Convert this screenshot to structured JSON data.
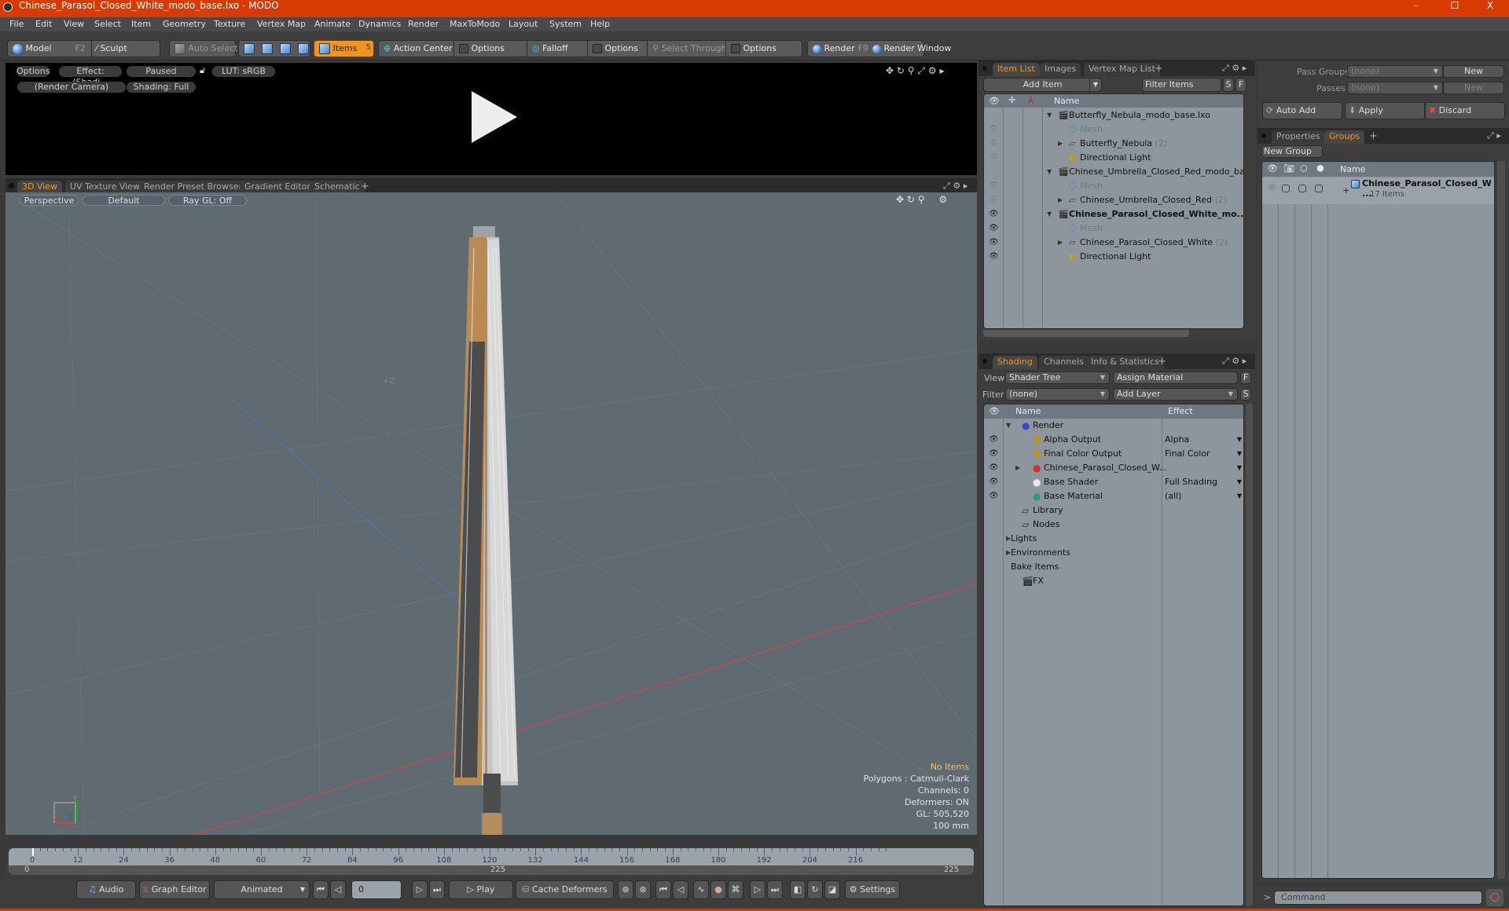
{
  "window": {
    "title": "Chinese_Parasol_Closed_White_modo_base.lxo - MODO",
    "controls": [
      "–",
      "☐",
      "X"
    ]
  },
  "menu": [
    "File",
    "Edit",
    "View",
    "Select",
    "Item",
    "Geometry",
    "Texture",
    "Vertex Map",
    "Animate",
    "Dynamics",
    "Render",
    "MaxToModo",
    "Layout",
    "System",
    "Help"
  ],
  "toolbar": {
    "model": "Model",
    "model_key": "F2",
    "sculpt": "Sculpt",
    "auto_select": "Auto Select",
    "items": "Items",
    "items_count": "5",
    "action_center": "Action Center",
    "options1": "Options",
    "falloff": "Falloff",
    "options2": "Options",
    "select_through": "Select Through",
    "options3": "Options",
    "render": "Render",
    "render_key": "F9",
    "render_window": "Render Window",
    "accent": "#f0961f"
  },
  "render_preview": {
    "options": "Options",
    "effect": "Effect: (Shadi...",
    "status": "Paused",
    "lut": "LUT: sRGB",
    "camera": "(Render Camera)",
    "shading": "Shading: Full"
  },
  "viewport_tabs": [
    "3D View",
    "UV Texture View",
    "Render Preset Browser",
    "Gradient Editor",
    "Schematic"
  ],
  "viewport": {
    "projection": "Perspective",
    "style": "Default",
    "raygl": "Ray GL: Off",
    "axis_label": "+Z",
    "info": {
      "selection": "No Items",
      "polygons": "Polygons : Catmull-Clark",
      "channels": "Channels: 0",
      "deformers": "Deformers: ON",
      "gl": "GL: 505,520",
      "scale": "100 mm"
    }
  },
  "timeline": {
    "ticks": [
      "0",
      "12",
      "24",
      "36",
      "48",
      "60",
      "72",
      "84",
      "96",
      "108",
      "120",
      "132",
      "144",
      "156",
      "168",
      "180",
      "192",
      "204",
      "216"
    ],
    "range_start": "0",
    "range_mid": "225",
    "range_end": "225",
    "current_frame": 0,
    "max_frame": 225
  },
  "transport": {
    "audio": "Audio",
    "graph_editor": "Graph Editor",
    "animated": "Animated",
    "frame": "0",
    "play": "Play",
    "cache_deformers": "Cache Deformers",
    "settings": "Settings"
  },
  "item_list": {
    "tabs": [
      "Item List",
      "Images",
      "Vertex Map List"
    ],
    "add_item": "Add Item",
    "filter_items": "Filter Items",
    "s_btn": "S",
    "f_btn": "F",
    "col_name": "Name",
    "rows": [
      {
        "name": "Butterfly_Nebula_modo_base.lxo",
        "type": "scene",
        "depth": 0,
        "eye": "none",
        "expand": "open"
      },
      {
        "name": "Mesh",
        "type": "mesh",
        "depth": 1,
        "eye": "dim",
        "dim": true
      },
      {
        "name": "Butterfly_Nebula",
        "count": "(2)",
        "type": "group",
        "depth": 1,
        "eye": "dim",
        "expand": "closed"
      },
      {
        "name": "Directional Light",
        "type": "light",
        "depth": 1,
        "eye": "dim"
      },
      {
        "name": "Chinese_Umbrella_Closed_Red_modo_ba ...",
        "type": "scene",
        "depth": 0,
        "eye": "none",
        "expand": "open"
      },
      {
        "name": "Mesh",
        "type": "mesh",
        "depth": 1,
        "eye": "dim",
        "dim": true
      },
      {
        "name": "Chinese_Umbrella_Closed_Red",
        "count": "(2)",
        "type": "group",
        "depth": 1,
        "eye": "dim",
        "expand": "closed"
      },
      {
        "name": "Chinese_Parasol_Closed_White_mo...",
        "type": "scene",
        "depth": 0,
        "eye": "on",
        "expand": "open",
        "bold": true
      },
      {
        "name": "Mesh",
        "type": "mesh",
        "depth": 1,
        "eye": "on",
        "dim": true
      },
      {
        "name": "Chinese_Parasol_Closed_White",
        "count": "(2)",
        "type": "group",
        "depth": 1,
        "eye": "on",
        "expand": "closed"
      },
      {
        "name": "Directional Light",
        "type": "light",
        "depth": 1,
        "eye": "on"
      }
    ]
  },
  "pass_groups": {
    "pass_groups_label": "Pass Groups",
    "pass_groups_value": "(none)",
    "passes_label": "Passes",
    "passes_value": "(none)",
    "new1": "New",
    "new2": "New",
    "auto_add": "Auto Add",
    "apply": "Apply",
    "discard": "Discard"
  },
  "groups_panel": {
    "tabs": [
      "Properties",
      "Groups"
    ],
    "new_group": "New Group",
    "col_name": "Name",
    "group_name": "Chinese_Parasol_Closed_W ...",
    "group_count": "17 Items"
  },
  "shading": {
    "tabs": [
      "Shading",
      "Channels",
      "Info & Statistics"
    ],
    "view_label": "View",
    "view_value": "Shader Tree",
    "assign_material": "Assign Material",
    "f_btn": "F",
    "filter_label": "Filter",
    "filter_value": "(none)",
    "add_layer": "Add Layer",
    "s_btn": "S",
    "col_name": "Name",
    "col_effect": "Effect",
    "rows": [
      {
        "name": "Render",
        "icon": "render",
        "depth": 0,
        "eye": false,
        "effect": "",
        "expand": "open"
      },
      {
        "name": "Alpha Output",
        "icon": "output",
        "depth": 1,
        "eye": true,
        "effect": "Alpha"
      },
      {
        "name": "Final Color Output",
        "icon": "output",
        "depth": 1,
        "eye": true,
        "effect": "Final Color"
      },
      {
        "name": "Chinese_Parasol_Closed_W...",
        "icon": "material-group",
        "depth": 1,
        "eye": true,
        "effect": "",
        "expand": "closed"
      },
      {
        "name": "Base Shader",
        "icon": "shader",
        "depth": 1,
        "eye": true,
        "effect": "Full Shading"
      },
      {
        "name": "Base Material",
        "icon": "material",
        "depth": 1,
        "eye": true,
        "effect": "(all)"
      },
      {
        "name": "Library",
        "icon": "folder",
        "depth": 0,
        "eye": false,
        "effect": ""
      },
      {
        "name": "Nodes",
        "icon": "folder",
        "depth": 0,
        "eye": false,
        "effect": ""
      },
      {
        "name": "Lights",
        "icon": "none",
        "depth": -1,
        "eye": false,
        "effect": "",
        "expand": "closed"
      },
      {
        "name": "Environments",
        "icon": "none",
        "depth": -1,
        "eye": false,
        "effect": "",
        "expand": "closed"
      },
      {
        "name": "Bake Items",
        "icon": "none",
        "depth": -1,
        "eye": false,
        "effect": ""
      },
      {
        "name": "FX",
        "icon": "clapper",
        "depth": 0,
        "eye": false,
        "effect": ""
      }
    ]
  },
  "command": {
    "prompt": ">",
    "placeholder": "Command"
  }
}
